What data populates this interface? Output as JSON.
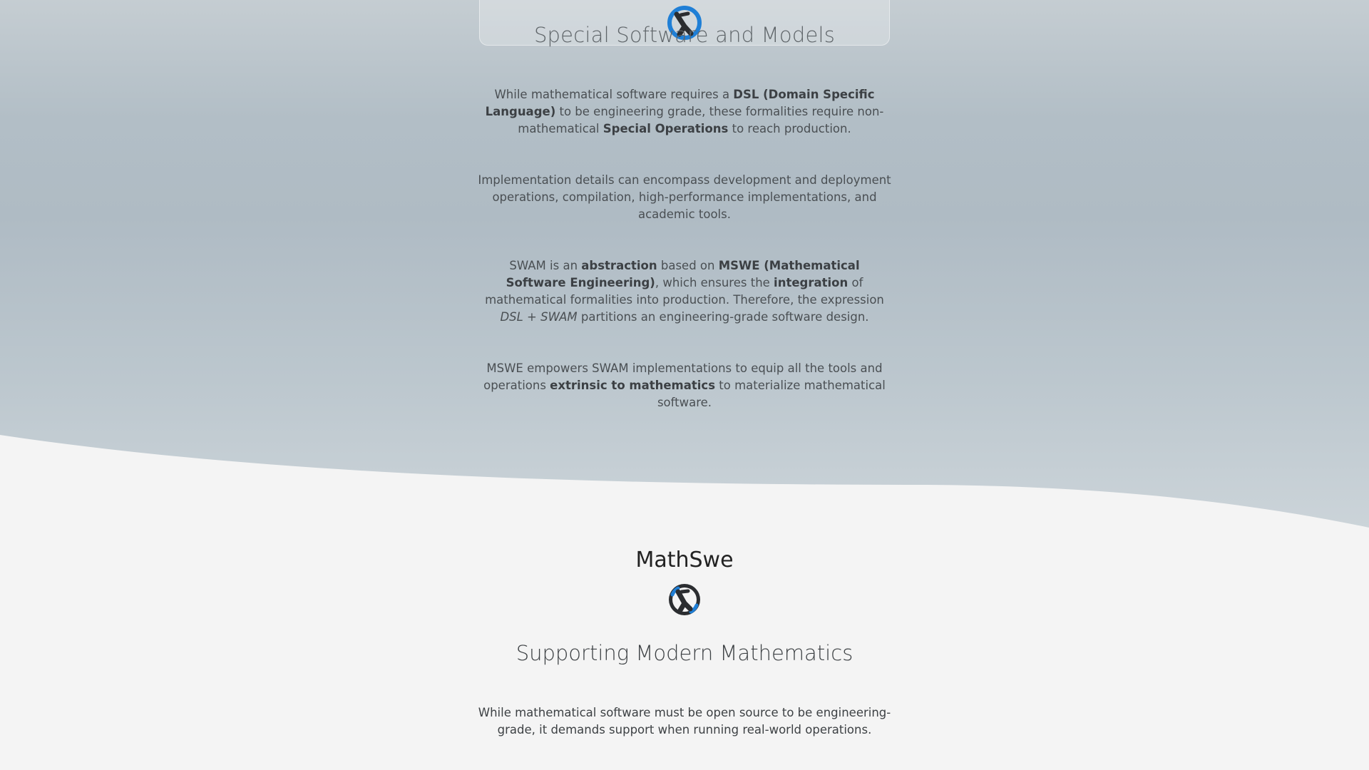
{
  "special_section": {
    "title": "Special Software and Models",
    "paragraphs": [
      {
        "parts": [
          {
            "t": "While mathematical software requires a "
          },
          {
            "t": "DSL (Domain Specific Language)",
            "b": true
          },
          {
            "t": " to be engineering grade, these formalities require non-mathematical "
          },
          {
            "t": "Special Operations",
            "b": true
          },
          {
            "t": " to reach production."
          }
        ]
      },
      {
        "parts": [
          {
            "t": "Implementation details can encompass development and deployment operations, compilation, high-performance implementations, and academic tools."
          }
        ]
      },
      {
        "parts": [
          {
            "t": "SWAM is an "
          },
          {
            "t": "abstraction",
            "b": true
          },
          {
            "t": " based on "
          },
          {
            "t": "MSWE (Mathematical Software Engineering)",
            "b": true
          },
          {
            "t": ", which ensures the "
          },
          {
            "t": "integration",
            "b": true
          },
          {
            "t": " of mathematical formalities into production. Therefore, the expression "
          },
          {
            "t": "DSL + SWAM",
            "i": true
          },
          {
            "t": " partitions an engineering-grade software design."
          }
        ]
      },
      {
        "parts": [
          {
            "t": "MSWE empowers SWAM implementations to equip all the tools and operations "
          },
          {
            "t": "extrinsic to mathematics",
            "b": true
          },
          {
            "t": " to materialize mathematical software."
          }
        ]
      }
    ]
  },
  "brand": {
    "name": "MathSwe"
  },
  "support_section": {
    "title": "Supporting Modern Mathematics",
    "paragraph": {
      "parts": [
        {
          "t": "While mathematical software must be open source to be engineering-grade, it demands support when running real-world operations."
        }
      ]
    }
  },
  "colors": {
    "logo_blue": "#1f7fd6",
    "logo_dark": "#2b2d30",
    "page_background": "#f4f4f4"
  },
  "icons": {
    "header_logo": "mathswe-logo-icon",
    "brand_logo": "mathswe-logo-icon"
  }
}
